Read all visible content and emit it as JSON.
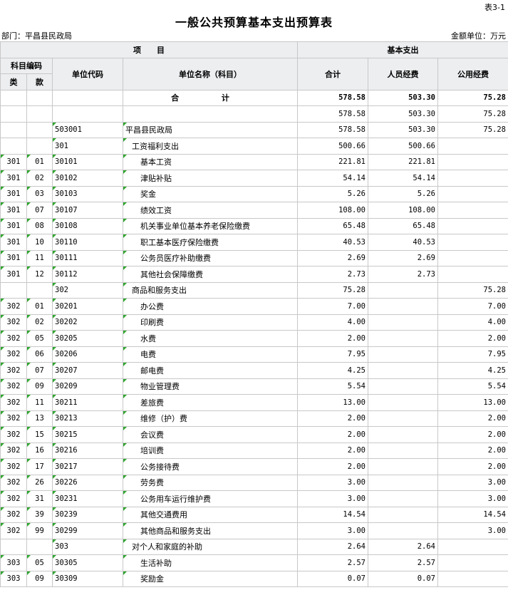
{
  "header": {
    "table_no": "表3-1",
    "title": "一般公共预算基本支出预算表",
    "department": "部门：平昌县民政局",
    "unit": "金额单位：万元"
  },
  "columns": {
    "item": "项　　目",
    "basic": "基本支出",
    "subject_code": "科目编码",
    "lei": "类",
    "kuan": "款",
    "unit_code": "单位代码",
    "unit_name": "单位名称（科目）",
    "total": "合计",
    "personnel": "人员经费",
    "public": "公用经费"
  },
  "total_row": {
    "label": "合 计",
    "total": "578.58",
    "personnel": "503.30",
    "public": "75.28"
  },
  "rows": [
    {
      "lei": "",
      "kuan": "",
      "code": "",
      "name": "",
      "level": 0,
      "total": "578.58",
      "personnel": "503.30",
      "public": "75.28"
    },
    {
      "lei": "",
      "kuan": "",
      "code": "503001",
      "name": "平昌县民政局",
      "level": 0,
      "total": "578.58",
      "personnel": "503.30",
      "public": "75.28"
    },
    {
      "lei": "",
      "kuan": "",
      "code": "301",
      "name": "工资福利支出",
      "level": 1,
      "total": "500.66",
      "personnel": "500.66",
      "public": ""
    },
    {
      "lei": "301",
      "kuan": "01",
      "code": "30101",
      "name": "基本工资",
      "level": 2,
      "total": "221.81",
      "personnel": "221.81",
      "public": ""
    },
    {
      "lei": "301",
      "kuan": "02",
      "code": "30102",
      "name": "津贴补贴",
      "level": 2,
      "total": "54.14",
      "personnel": "54.14",
      "public": ""
    },
    {
      "lei": "301",
      "kuan": "03",
      "code": "30103",
      "name": "奖金",
      "level": 2,
      "total": "5.26",
      "personnel": "5.26",
      "public": ""
    },
    {
      "lei": "301",
      "kuan": "07",
      "code": "30107",
      "name": "绩效工资",
      "level": 2,
      "total": "108.00",
      "personnel": "108.00",
      "public": ""
    },
    {
      "lei": "301",
      "kuan": "08",
      "code": "30108",
      "name": "机关事业单位基本养老保险缴费",
      "level": 2,
      "total": "65.48",
      "personnel": "65.48",
      "public": ""
    },
    {
      "lei": "301",
      "kuan": "10",
      "code": "30110",
      "name": "职工基本医疗保险缴费",
      "level": 2,
      "total": "40.53",
      "personnel": "40.53",
      "public": ""
    },
    {
      "lei": "301",
      "kuan": "11",
      "code": "30111",
      "name": "公务员医疗补助缴费",
      "level": 2,
      "total": "2.69",
      "personnel": "2.69",
      "public": ""
    },
    {
      "lei": "301",
      "kuan": "12",
      "code": "30112",
      "name": "其他社会保障缴费",
      "level": 2,
      "total": "2.73",
      "personnel": "2.73",
      "public": ""
    },
    {
      "lei": "",
      "kuan": "",
      "code": "302",
      "name": "商品和服务支出",
      "level": 1,
      "total": "75.28",
      "personnel": "",
      "public": "75.28"
    },
    {
      "lei": "302",
      "kuan": "01",
      "code": "30201",
      "name": "办公费",
      "level": 2,
      "total": "7.00",
      "personnel": "",
      "public": "7.00"
    },
    {
      "lei": "302",
      "kuan": "02",
      "code": "30202",
      "name": "印刷费",
      "level": 2,
      "total": "4.00",
      "personnel": "",
      "public": "4.00"
    },
    {
      "lei": "302",
      "kuan": "05",
      "code": "30205",
      "name": "水费",
      "level": 2,
      "total": "2.00",
      "personnel": "",
      "public": "2.00"
    },
    {
      "lei": "302",
      "kuan": "06",
      "code": "30206",
      "name": "电费",
      "level": 2,
      "total": "7.95",
      "personnel": "",
      "public": "7.95"
    },
    {
      "lei": "302",
      "kuan": "07",
      "code": "30207",
      "name": "邮电费",
      "level": 2,
      "total": "4.25",
      "personnel": "",
      "public": "4.25"
    },
    {
      "lei": "302",
      "kuan": "09",
      "code": "30209",
      "name": "物业管理费",
      "level": 2,
      "total": "5.54",
      "personnel": "",
      "public": "5.54"
    },
    {
      "lei": "302",
      "kuan": "11",
      "code": "30211",
      "name": "差旅费",
      "level": 2,
      "total": "13.00",
      "personnel": "",
      "public": "13.00"
    },
    {
      "lei": "302",
      "kuan": "13",
      "code": "30213",
      "name": "维修（护）费",
      "level": 2,
      "total": "2.00",
      "personnel": "",
      "public": "2.00"
    },
    {
      "lei": "302",
      "kuan": "15",
      "code": "30215",
      "name": "会议费",
      "level": 2,
      "total": "2.00",
      "personnel": "",
      "public": "2.00"
    },
    {
      "lei": "302",
      "kuan": "16",
      "code": "30216",
      "name": "培训费",
      "level": 2,
      "total": "2.00",
      "personnel": "",
      "public": "2.00"
    },
    {
      "lei": "302",
      "kuan": "17",
      "code": "30217",
      "name": "公务接待费",
      "level": 2,
      "total": "2.00",
      "personnel": "",
      "public": "2.00"
    },
    {
      "lei": "302",
      "kuan": "26",
      "code": "30226",
      "name": "劳务费",
      "level": 2,
      "total": "3.00",
      "personnel": "",
      "public": "3.00"
    },
    {
      "lei": "302",
      "kuan": "31",
      "code": "30231",
      "name": "公务用车运行维护费",
      "level": 2,
      "total": "3.00",
      "personnel": "",
      "public": "3.00"
    },
    {
      "lei": "302",
      "kuan": "39",
      "code": "30239",
      "name": "其他交通费用",
      "level": 2,
      "total": "14.54",
      "personnel": "",
      "public": "14.54"
    },
    {
      "lei": "302",
      "kuan": "99",
      "code": "30299",
      "name": "其他商品和服务支出",
      "level": 2,
      "total": "3.00",
      "personnel": "",
      "public": "3.00"
    },
    {
      "lei": "",
      "kuan": "",
      "code": "303",
      "name": "对个人和家庭的补助",
      "level": 1,
      "total": "2.64",
      "personnel": "2.64",
      "public": ""
    },
    {
      "lei": "303",
      "kuan": "05",
      "code": "30305",
      "name": "生活补助",
      "level": 2,
      "total": "2.57",
      "personnel": "2.57",
      "public": ""
    },
    {
      "lei": "303",
      "kuan": "09",
      "code": "30309",
      "name": "奖励金",
      "level": 2,
      "total": "0.07",
      "personnel": "0.07",
      "public": ""
    }
  ]
}
